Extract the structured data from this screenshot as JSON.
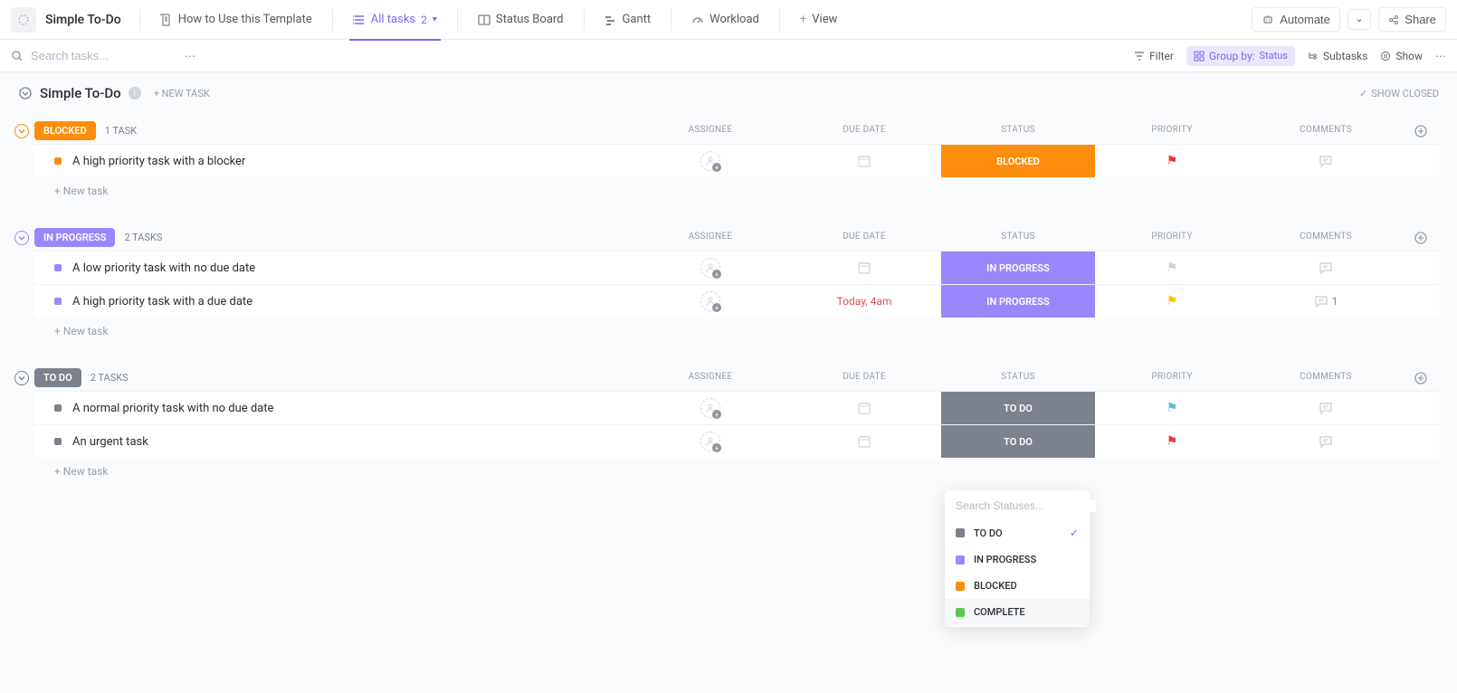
{
  "colors": {
    "blocked": "#fd8d0d",
    "in_progress": "#9b87fd",
    "todo": "#7c828d",
    "complete": "#5bc94b",
    "purple": "#7b68ee"
  },
  "nav": {
    "list_title": "Simple To-Do",
    "how_to": "How to Use this Template",
    "all_tasks": "All tasks",
    "all_tasks_count": "2",
    "status_board": "Status Board",
    "gantt": "Gantt",
    "workload": "Workload",
    "add_view": "View",
    "automate": "Automate",
    "share": "Share"
  },
  "toolbar": {
    "search_placeholder": "Search tasks...",
    "filter": "Filter",
    "group_by": "Group by:",
    "group_by_value": "Status",
    "subtasks": "Subtasks",
    "show": "Show"
  },
  "header": {
    "title": "Simple To-Do",
    "new_task": "+ NEW TASK",
    "show_closed": "SHOW CLOSED"
  },
  "columns": {
    "assignee": "ASSIGNEE",
    "due": "DUE DATE",
    "status": "STATUS",
    "priority": "PRIORITY",
    "comments": "COMMENTS"
  },
  "new_task_link": "+ New task",
  "groups": [
    {
      "key": "blocked",
      "label": "BLOCKED",
      "color": "#fd8d0d",
      "count_label": "1 TASK",
      "tasks": [
        {
          "title": "A high priority task with a blocker",
          "status": "BLOCKED",
          "status_color": "#fd8d0d",
          "priority": "red",
          "due": "",
          "comments": ""
        }
      ]
    },
    {
      "key": "in_progress",
      "label": "IN PROGRESS",
      "color": "#9b87fd",
      "count_label": "2 TASKS",
      "tasks": [
        {
          "title": "A low priority task with no due date",
          "status": "IN PROGRESS",
          "status_color": "#9b87fd",
          "priority": "grey",
          "due": "",
          "comments": ""
        },
        {
          "title": "A high priority task with a due date",
          "status": "IN PROGRESS",
          "status_color": "#9b87fd",
          "priority": "yellow",
          "due": "Today, 4am",
          "comments": "1"
        }
      ]
    },
    {
      "key": "todo",
      "label": "TO DO",
      "color": "#7c828d",
      "count_label": "2 TASKS",
      "tasks": [
        {
          "title": "A normal priority task with no due date",
          "status": "TO DO",
          "status_color": "#7c828d",
          "priority": "blue",
          "due": "",
          "comments": ""
        },
        {
          "title": "An urgent task",
          "status": "TO DO",
          "status_color": "#7c828d",
          "priority": "red",
          "due": "",
          "comments": ""
        }
      ]
    }
  ],
  "status_popup": {
    "search_placeholder": "Search Statuses...",
    "options": [
      {
        "label": "TO DO",
        "color": "#7c828d",
        "selected": true
      },
      {
        "label": "IN PROGRESS",
        "color": "#9b87fd",
        "selected": false
      },
      {
        "label": "BLOCKED",
        "color": "#fd8d0d",
        "selected": false
      },
      {
        "label": "COMPLETE",
        "color": "#5bc94b",
        "selected": false,
        "highlight": true
      }
    ]
  }
}
